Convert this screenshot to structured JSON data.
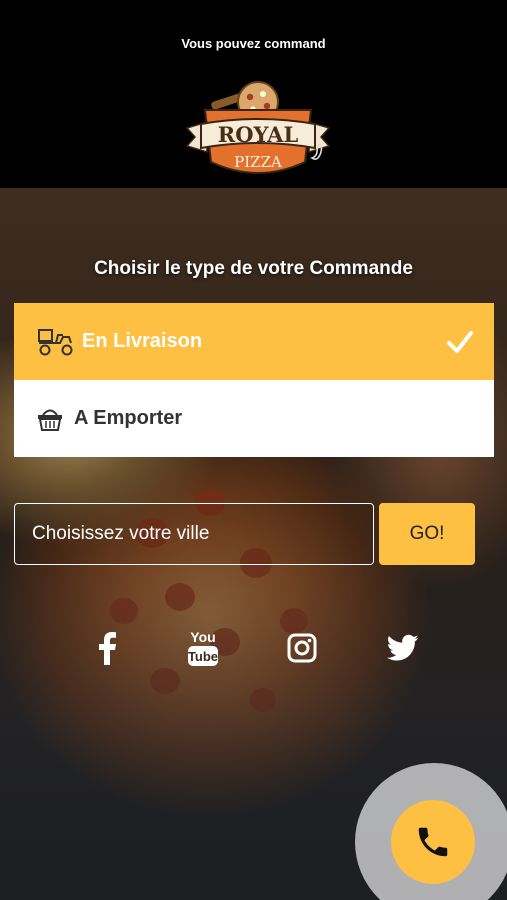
{
  "header": {
    "marquee_text": "Vous pouvez command",
    "logo": {
      "brand_top": "ROYAL",
      "brand_bottom": "PIZZA"
    }
  },
  "order": {
    "title": "Choisir le type de votre Commande",
    "options": [
      {
        "label": "En Livraison",
        "icon": "delivery-scooter-icon",
        "selected": true
      },
      {
        "label": "A Emporter",
        "icon": "basket-icon",
        "selected": false
      }
    ]
  },
  "city": {
    "placeholder": "Choisissez votre ville",
    "value": ""
  },
  "go_button": {
    "label": "GO!"
  },
  "social": [
    {
      "name": "facebook-icon"
    },
    {
      "name": "youtube-icon",
      "label_top": "You",
      "label_bottom": "Tube"
    },
    {
      "name": "instagram-icon"
    },
    {
      "name": "twitter-icon"
    }
  ],
  "call_button": {
    "icon": "phone-icon"
  },
  "colors": {
    "accent": "#fec043",
    "header_bg": "#000000",
    "white": "#ffffff"
  }
}
